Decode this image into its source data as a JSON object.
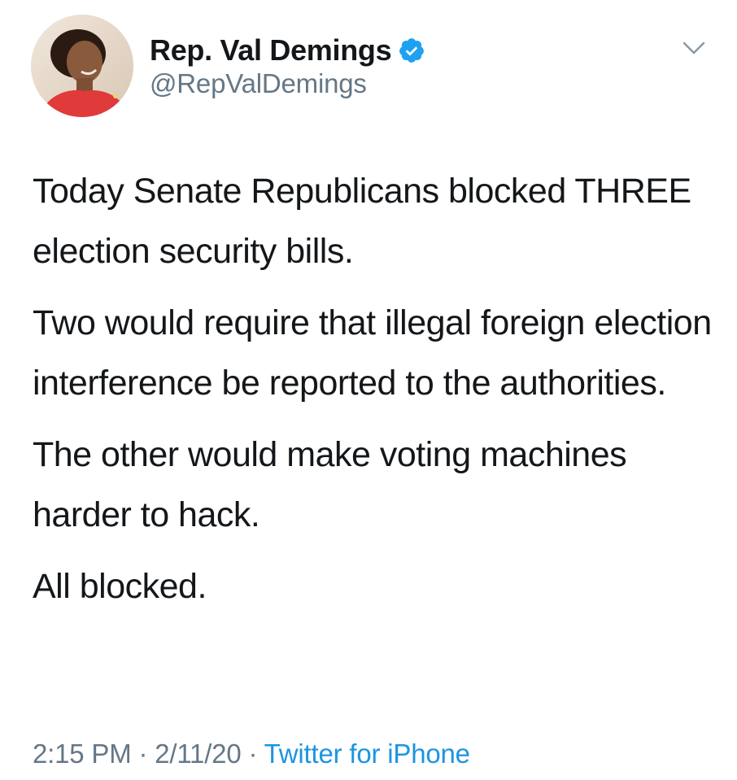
{
  "author": {
    "display_name": "Rep. Val Demings",
    "handle": "@RepValDemings",
    "verified": true
  },
  "tweet": {
    "paragraphs": [
      "Today Senate Republicans blocked THREE election security bills.",
      "Two would require that illegal foreign election interference be reported to the authorities.",
      "The other would make voting machines harder to hack.",
      "All blocked."
    ],
    "time": "2:15 PM",
    "date": "2/11/20",
    "source": "Twitter for iPhone",
    "separator": " · "
  },
  "colors": {
    "text": "#14171a",
    "secondary": "#657786",
    "link": "#1b95e0",
    "verified": "#1da1f2"
  },
  "icons": {
    "verified": "verified-badge-icon",
    "menu": "chevron-down-icon"
  }
}
